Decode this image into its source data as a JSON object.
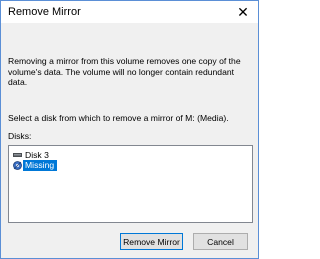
{
  "window": {
    "title": "Remove Mirror",
    "close_glyph": "✕"
  },
  "content": {
    "description": "Removing a mirror from this volume removes one copy of the volume's data. The volume will no longer contain redundant data.",
    "select_instruction": "Select a disk from which to remove a mirror of M: (Media).",
    "disks_label": "Disks:"
  },
  "disk_list": {
    "items": [
      {
        "label": "Disk 3",
        "icon": "disk-icon",
        "selected": false
      },
      {
        "label": "Missing",
        "icon": "missing-disk-icon",
        "selected": true
      }
    ]
  },
  "buttons": {
    "remove_mirror": "Remove Mirror",
    "cancel": "Cancel"
  },
  "colors": {
    "selection": "#0078d7",
    "window_border": "#5b8fd6",
    "dialog_background": "#f0f0f0"
  }
}
